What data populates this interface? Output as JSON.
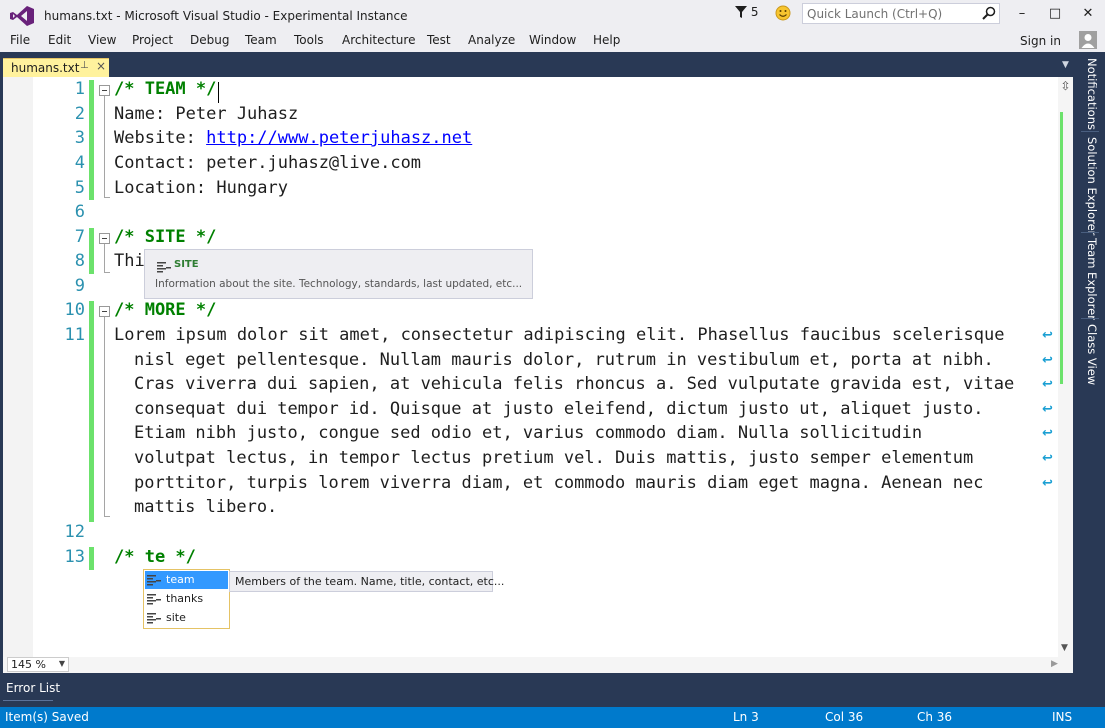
{
  "window": {
    "title": "humans.txt - Microsoft Visual Studio - Experimental Instance",
    "filter_count": "5",
    "quick_launch_placeholder": "Quick Launch (Ctrl+Q)",
    "minimize": "–",
    "maximize": "□",
    "close": "✕"
  },
  "menu": {
    "items": [
      "File",
      "Edit",
      "View",
      "Project",
      "Debug",
      "Team",
      "Tools",
      "Architecture",
      "Test",
      "Analyze",
      "Window",
      "Help"
    ],
    "sign_in": "Sign in"
  },
  "tab": {
    "label": "humans.txt",
    "pin": "⊥",
    "close": "×"
  },
  "editor": {
    "line_numbers": [
      "1",
      "2",
      "3",
      "4",
      "5",
      "6",
      "7",
      "8",
      "9",
      "10",
      "11",
      "12",
      "13"
    ],
    "lines": {
      "l1_comment": "/* TEAM */",
      "l2": "Name: Peter Juhasz",
      "l3_prefix": "Website: ",
      "l3_link": "http://www.peterjuhasz.net",
      "l4": "Contact: peter.juhasz@live.com",
      "l5": "Location: Hungary",
      "l7_comment": "/* SITE */",
      "l8_partial": "Thi",
      "l9_comment": "/* MORE */",
      "l11_wrapped": [
        "Lorem ipsum dolor sit amet, consectetur adipiscing elit. Phasellus faucibus scelerisque",
        "nisl eget pellentesque. Nullam mauris dolor, rutrum in vestibulum et, porta at nibh.",
        "Cras viverra dui sapien, at vehicula felis rhoncus a. Sed vulputate gravida est, vitae",
        "consequat dui tempor id. Quisque at justo eleifend, dictum justo ut, aliquet justo.",
        "Etiam nibh justo, congue sed odio et, varius commodo diam. Nulla sollicitudin",
        "volutpat lectus, in tempor lectus pretium vel. Duis mattis, justo semper elementum",
        "porttitor, turpis lorem viverra diam, et commodo mauris diam eget magna. Aenean nec",
        "mattis libero."
      ],
      "l13_comment": "/* te */"
    },
    "zoom": "145 %"
  },
  "quick_info": {
    "title": "SITE",
    "description": "Information about the site. Technology, standards, last updated, etc..."
  },
  "completion": {
    "items": [
      "team",
      "thanks",
      "site"
    ],
    "selected": "team",
    "tooltip": "Members of the team. Name, title, contact, etc..."
  },
  "tool_windows": [
    "Notifications",
    "Solution Explorer",
    "Team Explorer",
    "Class View"
  ],
  "bottom_panel": {
    "error_list": "Error List"
  },
  "status": {
    "message": "Item(s) Saved",
    "line": "Ln 3",
    "col": "Col 36",
    "ch": "Ch 36",
    "mode": "INS"
  },
  "colors": {
    "accent": "#007acc",
    "frame": "#293955",
    "tab_active": "#fff29d",
    "comment": "#008000",
    "line_number": "#2b91af",
    "change_bar": "#6ce26c",
    "selection": "#3399ff"
  }
}
